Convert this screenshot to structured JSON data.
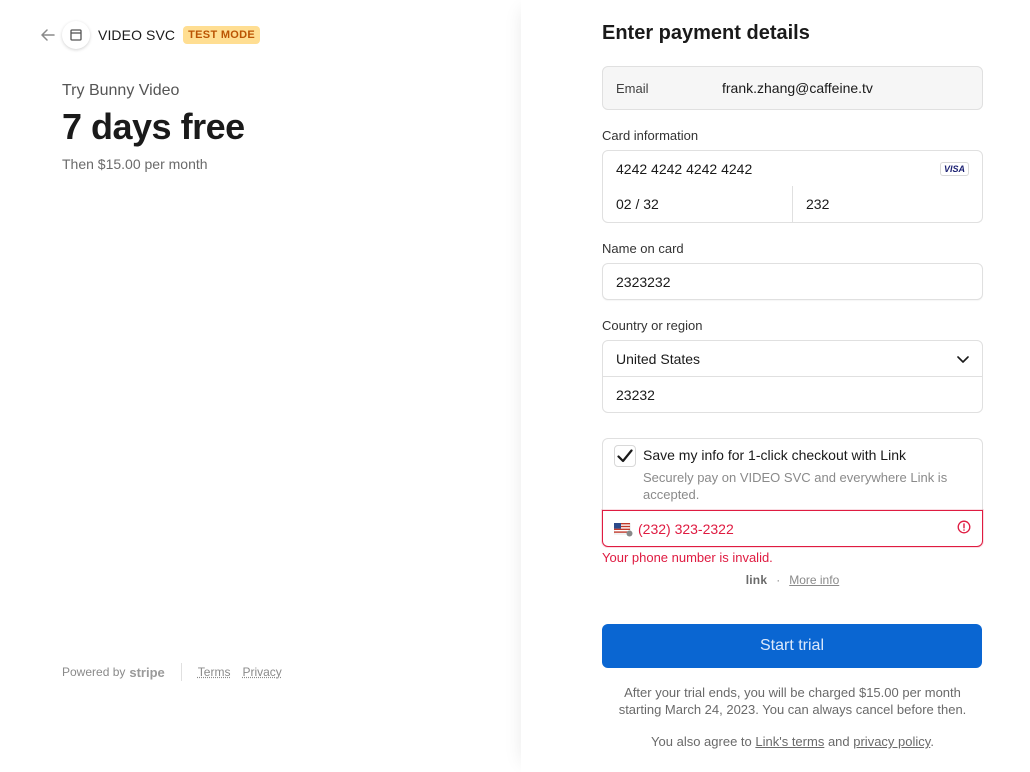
{
  "header": {
    "brand": "VIDEO SVC",
    "badge": "TEST MODE"
  },
  "product": {
    "name": "Try Bunny Video",
    "price": "7 days free",
    "then": "Then $15.00 per month"
  },
  "footer": {
    "powered": "Powered by",
    "stripe": "stripe",
    "terms": "Terms",
    "privacy": "Privacy"
  },
  "form": {
    "title": "Enter payment details",
    "email_label": "Email",
    "email_value": "frank.zhang@caffeine.tv",
    "card_label": "Card information",
    "card_number": "4242 4242 4242 4242",
    "card_brand": "VISA",
    "expiry": "02 / 32",
    "cvc": "232",
    "name_label": "Name on card",
    "name_value": "2323232",
    "country_label": "Country or region",
    "country_value": "United States",
    "zip_value": "23232",
    "link_title": "Save my info for 1-click checkout with Link",
    "link_sub": "Securely pay on VIDEO SVC and everywhere Link is accepted.",
    "phone_value": "(232) 323-2322",
    "phone_error": "Your phone number is invalid.",
    "link_logo": "link",
    "link_dot": "·",
    "more_info": "More info",
    "button": "Start trial",
    "fine_print": "After your trial ends, you will be charged $15.00 per month starting March 24, 2023. You can always cancel before then.",
    "agree_prefix": "You also agree to ",
    "link_terms": "Link's terms",
    "agree_and": " and ",
    "privacy_policy": "privacy policy",
    "agree_suffix": "."
  },
  "colors": {
    "accent": "#0a66d2",
    "error": "#df1b41",
    "badge_bg": "#ffde92",
    "badge_text": "#bb5504"
  }
}
